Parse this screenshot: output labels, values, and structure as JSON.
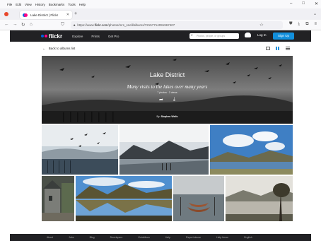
{
  "browser": {
    "menu": [
      "File",
      "Edit",
      "View",
      "History",
      "Bookmarks",
      "Tools",
      "Help"
    ],
    "tab_title": "Lake District | Flickr",
    "url_prefix": "https://www.",
    "url_host": "flickr.com",
    "url_path": "/photos/mrs_snell/albums/72157714091967407"
  },
  "header": {
    "logo": "flickr",
    "nav": [
      "Explore",
      "Prints",
      "Get Pro"
    ],
    "search_placeholder": "Photos, people, or groups",
    "login": "Log In",
    "signup": "Sign Up"
  },
  "page": {
    "back_link": "Back to albums list"
  },
  "album": {
    "title": "Lake District",
    "description": "Many visits to the lakes over many years",
    "stats": "7 photos  ·  2 views",
    "owner_prefix": "By:",
    "owner_name": "Stephen Wells"
  },
  "colors": {
    "flickr_blue": "#0063dc",
    "flickr_pink": "#ff0084",
    "signup_blue": "#128fdc",
    "header_bg": "#212124"
  },
  "photos": [
    {
      "subject": "birds over misty lake at sunrise"
    },
    {
      "subject": "mountain lake with jetty posts"
    },
    {
      "subject": "lake with clouds and blue sky"
    },
    {
      "subject": "stone cottage lane"
    },
    {
      "subject": "mountain reflection in lake"
    },
    {
      "subject": "rowing boats at jetty in mist"
    },
    {
      "subject": "tree and hills by lake"
    }
  ],
  "footer": {
    "links": [
      "About",
      "Jobs",
      "Blog",
      "Developers",
      "Guidelines",
      "Help",
      "Report abuse",
      "Help forum",
      "English"
    ]
  }
}
